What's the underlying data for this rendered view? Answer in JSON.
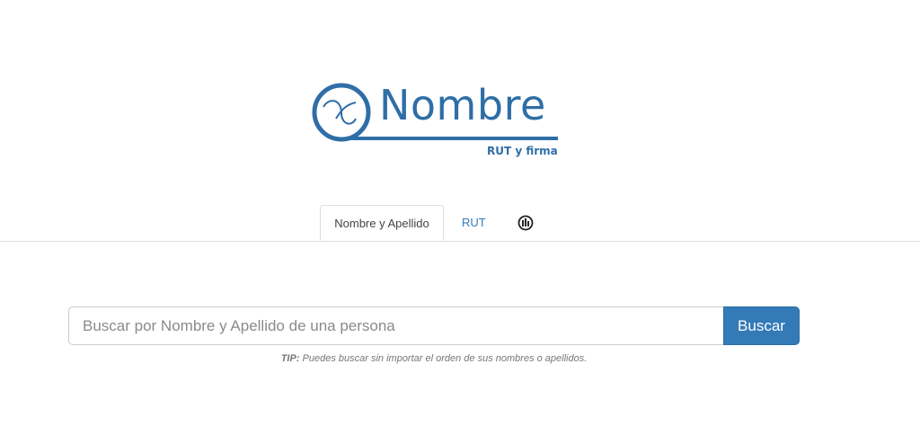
{
  "brand": {
    "name": "Nombre",
    "subtitle": "RUT y firma",
    "color": "#2f6ea6"
  },
  "tabs": [
    {
      "label": "Nombre y Apellido",
      "active": true
    },
    {
      "label": "RUT",
      "active": false
    },
    {
      "label": "",
      "icon": "directory-icon",
      "active": false
    }
  ],
  "search": {
    "placeholder": "Buscar por Nombre y Apellido de una persona",
    "value": "",
    "button_label": "Buscar",
    "button_color": "#337ab7"
  },
  "tip": {
    "label": "TIP:",
    "text": " Puedes buscar sin importar el orden de sus nombres o apellidos."
  }
}
